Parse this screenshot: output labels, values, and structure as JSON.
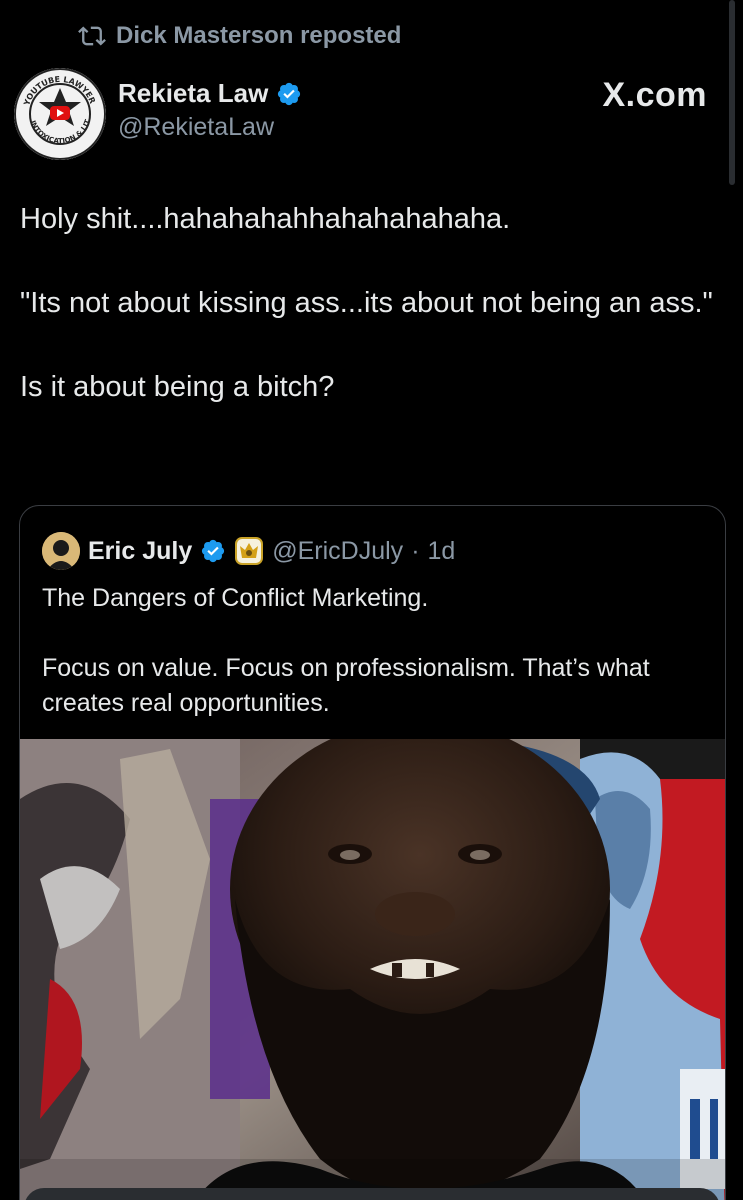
{
  "repost": {
    "label": "Dick Masterson reposted",
    "icon": "repost-icon"
  },
  "post": {
    "author_name": "Rekieta Law",
    "author_handle": "@RekietaLaw",
    "verified": true,
    "avatar_logo_text": "YOUTUBE LAWYER · LITIGATION · INTOXICATION",
    "site_label": "X.com",
    "text_lines": [
      "Holy shit....hahahahahhahahahahaha.",
      "\"Its not about kissing ass...its about not being an ass.\"",
      "Is it about being a bitch?"
    ]
  },
  "quote": {
    "author_name": "Eric July",
    "verified": true,
    "badge_icon": "gold-crest-icon",
    "author_handle": "@EricDJuly",
    "separator": "·",
    "time": "1d",
    "text_lines": [
      "The Dangers of Conflict Marketing.",
      "Focus on value. Focus on professionalism. That’s what creates real opportunities."
    ],
    "media": "video-thumbnail"
  },
  "colors": {
    "background": "#000000",
    "text_primary": "#e7e9ea",
    "text_secondary": "#8b98a5",
    "verified_blue": "#1d9bf0",
    "card_border": "#3a3d42"
  }
}
